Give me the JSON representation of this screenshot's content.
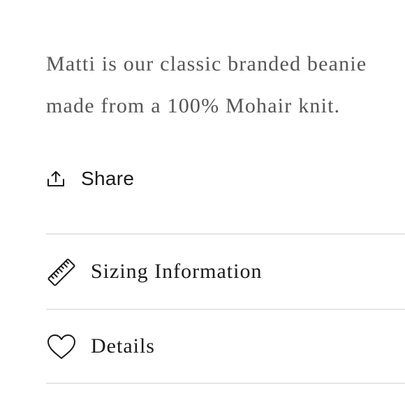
{
  "product": {
    "description": "Matti is our classic branded beanie made from a 100% Mohair knit."
  },
  "share": {
    "icon": "share-icon",
    "label": "Share"
  },
  "accordion": {
    "items": [
      {
        "icon": "ruler-icon",
        "label": "Sizing Information"
      },
      {
        "icon": "heart-icon",
        "label": "Details"
      }
    ]
  },
  "colors": {
    "text_body": "#555555",
    "text_strong": "#1a1a1a",
    "divider": "#e6e6e6"
  }
}
